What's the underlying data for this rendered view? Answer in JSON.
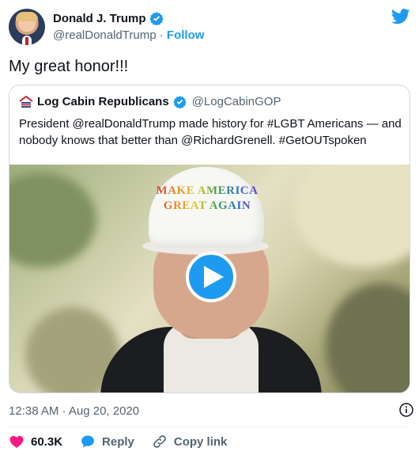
{
  "author": {
    "name": "Donald J. Trump",
    "handle": "@realDonaldTrump",
    "separator": "·",
    "follow_label": "Follow"
  },
  "tweet": {
    "text": "My great honor!!!",
    "timestamp": "12:38 AM · Aug 20, 2020"
  },
  "quote": {
    "name": "Log Cabin Republicans",
    "handle": "@LogCabinGOP",
    "text": "President @realDonaldTrump made history for #LGBT Americans — and nobody knows that better than @RichardGrenell. #GetOUTspoken"
  },
  "video": {
    "cap_text": "MAKE AMERICA GREAT AGAIN"
  },
  "actions": {
    "likes": "60.3K",
    "reply_label": "Reply",
    "copy_label": "Copy link"
  },
  "colors": {
    "accent": "#1d9bf0",
    "like": "#f91880",
    "secondary_text": "#536471"
  }
}
